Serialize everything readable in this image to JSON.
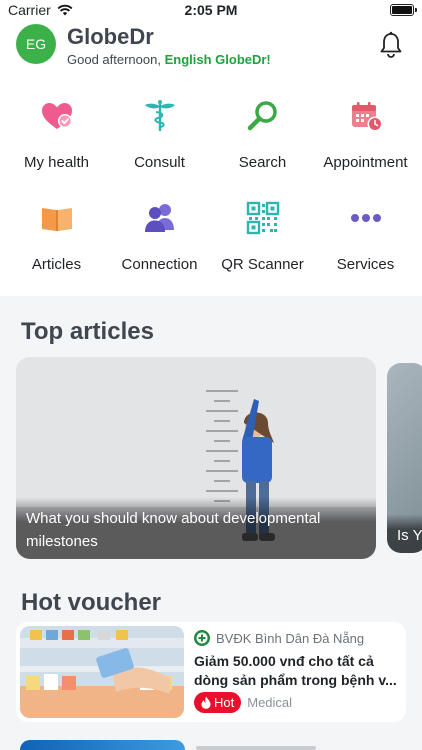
{
  "status": {
    "carrier": "Carrier",
    "time": "2:05 PM"
  },
  "header": {
    "avatar_initials": "EG",
    "app_name": "GlobeDr",
    "greeting": "Good afternoon,",
    "user_name": "English GlobeDr!"
  },
  "shortcuts": [
    {
      "label": "My health",
      "icon": "heart-check-icon"
    },
    {
      "label": "Consult",
      "icon": "caduceus-icon"
    },
    {
      "label": "Search",
      "icon": "magnifier-icon"
    },
    {
      "label": "Appointment",
      "icon": "calendar-clock-icon"
    },
    {
      "label": "Articles",
      "icon": "book-icon"
    },
    {
      "label": "Connection",
      "icon": "people-icon"
    },
    {
      "label": "QR Scanner",
      "icon": "qr-code-icon"
    },
    {
      "label": "Services",
      "icon": "more-dots-icon"
    }
  ],
  "top_articles": {
    "title": "Top articles",
    "items": [
      {
        "caption": "What you should know about developmental milestones"
      },
      {
        "caption": "Is Y"
      }
    ]
  },
  "hot_voucher": {
    "title": "Hot voucher",
    "items": [
      {
        "shop": "BVĐK Bình Dân Đà Nẵng",
        "title": "Giảm 50.000 vnđ cho tất cả dòng sản phẩm trong bệnh v...",
        "badge": "Hot",
        "category": "Medical"
      }
    ]
  },
  "colors": {
    "brand_green": "#3cb14a",
    "hot_red": "#e8102b",
    "pink": "#ef5b8f",
    "purple": "#6b5bc4",
    "teal": "#2bb6b2"
  }
}
